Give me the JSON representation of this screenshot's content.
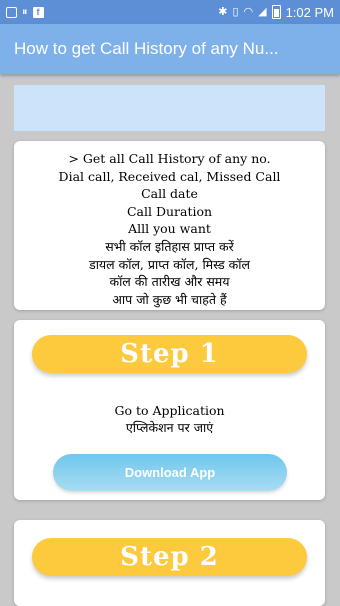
{
  "status_bar": {
    "time": "1:02 PM",
    "left_icons": [
      "notification-icon",
      "pause-icon",
      "facebook-icon"
    ],
    "right_icons": [
      "bluetooth-icon",
      "vibrate-icon",
      "wifi-icon",
      "signal-icon",
      "battery-icon"
    ]
  },
  "app_bar": {
    "title": "How to get Call History of any Nu..."
  },
  "info_card": {
    "lines": [
      "> Get all Call History of any no.",
      "Dial call, Received cal, Missed Call",
      "Call date",
      "Call Duration",
      "Alll you want",
      "सभी कॉल इतिहास प्राप्त करें",
      "डायल कॉल, प्राप्त कॉल, मिस्ड कॉल",
      "कॉल की तारीख और समय",
      "आप जो कुछ भी चाहते हैं"
    ]
  },
  "step1": {
    "title": "Step 1",
    "desc_en": "Go to Application",
    "desc_hi": "एप्लिकेशन पर जाएं",
    "button": "Download App"
  },
  "step2": {
    "title": "Step 2"
  },
  "colors": {
    "status_bar": "#5d8fd6",
    "app_bar": "#7eb1ea",
    "step_pill": "#fcca3c",
    "download_button": "#6fc6ee",
    "background": "#c9c9c9"
  }
}
